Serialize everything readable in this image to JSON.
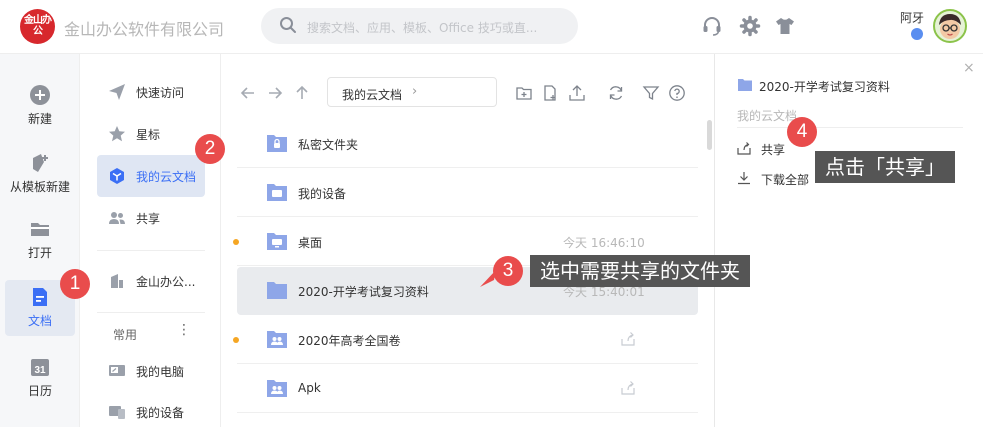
{
  "header": {
    "logo_text": "金山办公",
    "company": "金山办公软件有限公司",
    "search_placeholder": "搜索文档、应用、模板、Office 技巧或直...",
    "icons": [
      "headset-icon",
      "gear-icon",
      "tshirt-icon"
    ],
    "username": "阿牙"
  },
  "leftnav": {
    "items": [
      {
        "label": "新建",
        "icon": "plus-circle-icon"
      },
      {
        "label": "从模板新建",
        "icon": "template-icon"
      },
      {
        "label": "打开",
        "icon": "folder-open-icon"
      },
      {
        "label": "文档",
        "icon": "document-icon",
        "active": true
      },
      {
        "label": "日历",
        "icon": "calendar-icon",
        "calendar_day": "31"
      }
    ]
  },
  "sidebar": {
    "items": [
      {
        "label": "快速访问",
        "icon": "paper-plane-icon"
      },
      {
        "label": "星标",
        "icon": "star-icon"
      },
      {
        "label": "我的云文档",
        "icon": "cube-icon",
        "active": true
      },
      {
        "label": "共享",
        "icon": "people-icon"
      },
      {
        "label": "金山办公...",
        "icon": "building-icon"
      }
    ],
    "section_label": "常用",
    "more": "⋮",
    "common_items": [
      {
        "label": "我的电脑",
        "icon": "computer-icon"
      },
      {
        "label": "我的设备",
        "icon": "devices-icon"
      }
    ]
  },
  "toolbar": {
    "breadcrumb": "我的云文档",
    "breadcrumb_arrow": "›",
    "left_icons": [
      "back-arrow-icon",
      "forward-arrow-icon",
      "up-arrow-icon"
    ],
    "right_icons": [
      "new-folder-icon",
      "new-file-icon",
      "upload-icon",
      "refresh-icon",
      "filter-icon",
      "help-icon"
    ]
  },
  "files": [
    {
      "name": "私密文件夹",
      "icon": "lock-folder-icon",
      "time": "",
      "dot": false,
      "share": false
    },
    {
      "name": "我的设备",
      "icon": "device-folder-icon",
      "time": "",
      "dot": false,
      "share": false
    },
    {
      "name": "桌面",
      "icon": "desktop-folder-icon",
      "time": "今天 16:46:10",
      "dot": true,
      "share": false
    },
    {
      "name": "2020-开学考试复习资料",
      "icon": "folder-icon",
      "time": "今天 15:40:01",
      "dot": false,
      "share": false,
      "selected": true
    },
    {
      "name": "2020年高考全国卷",
      "icon": "shared-folder-icon",
      "time": "",
      "dot": true,
      "share": true
    },
    {
      "name": "Apk",
      "icon": "shared-folder-icon",
      "time": "",
      "dot": false,
      "share": true
    }
  ],
  "detail": {
    "title": "2020-开学考试复习资料",
    "path": "我的云文档",
    "close": "×",
    "actions": [
      {
        "label": "共享",
        "icon": "share-icon"
      },
      {
        "label": "下载全部",
        "icon": "download-icon"
      }
    ]
  },
  "annotations": [
    {
      "number": "1"
    },
    {
      "number": "2"
    },
    {
      "number": "3",
      "text": "选中需要共享的文件夹"
    },
    {
      "number": "4",
      "text": "点击「共享」"
    }
  ],
  "colors": {
    "accent": "#3b6ff5",
    "folder": "#8ea6e8",
    "step": "#e94c4c",
    "callout": "#555555",
    "dot": "#f5a623"
  }
}
